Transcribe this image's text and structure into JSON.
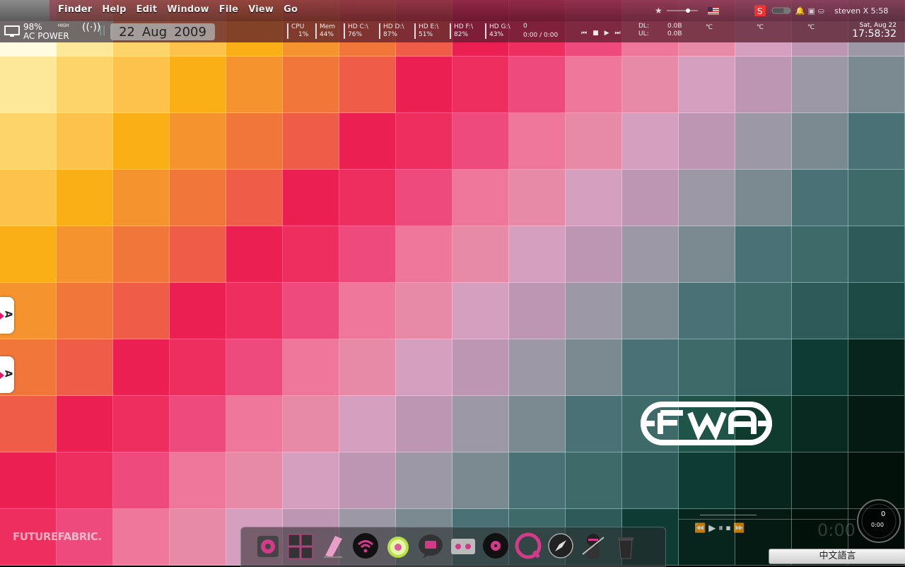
{
  "menubar": {
    "items": [
      "Finder",
      "Help",
      "Edit",
      "Window",
      "File",
      "View",
      "Go"
    ],
    "user_time": "steven X 5:58"
  },
  "statusbar": {
    "battery_percent": "98%",
    "battery_level_label": "HIGH",
    "power_source": "AC POWER",
    "date": {
      "day": "22",
      "month": "Aug",
      "year": "2009"
    },
    "meters": [
      {
        "label": "CPU",
        "value": "1%"
      },
      {
        "label": "Mem",
        "value": "44%"
      },
      {
        "label": "HD C:\\",
        "value": "76%"
      },
      {
        "label": "HD D:\\",
        "value": "87%"
      },
      {
        "label": "HD E:\\",
        "value": "51%"
      },
      {
        "label": "HD F:\\",
        "value": "82%"
      },
      {
        "label": "HD G:\\",
        "value": "43%"
      }
    ],
    "media_count": "0",
    "media_time": "0:00 / 0:00",
    "network": {
      "dl_label": "DL:",
      "dl_value": "0.0B",
      "ul_label": "UL:",
      "ul_value": "0.0B"
    },
    "temps": [
      "℃",
      "℃",
      "℃"
    ],
    "clock_date": "Sat, Aug 22",
    "clock_time": "17:58:32"
  },
  "side_tabs": [
    {
      "letter": "A"
    },
    {
      "letter": "A"
    }
  ],
  "brand_text": "FUTUREFABRIC.",
  "media_widget": {
    "time": "0:00",
    "dial_count": "0",
    "dial_time": "0:00"
  },
  "language_bar": {
    "label": "中文語言"
  },
  "dock": {
    "icons": [
      "cd-burner-icon",
      "grid-app-icon",
      "beach-chair-icon",
      "wifi-icon",
      "lime-icon",
      "ichat-icon",
      "cassette-icon",
      "vinyl-record-icon",
      "quicktime-icon",
      "safari-compass-icon",
      "ninja-icon",
      "trash-icon"
    ]
  },
  "colors": {
    "grid": [
      [
        "#fffbe0",
        "#fde89a",
        "#fdd46a",
        "#fdc24c",
        "#fbaf17",
        "#f5932f",
        "#f1763a",
        "#ef5c48",
        "#ec1f53",
        "#ed2e5f",
        "#ef4a7d",
        "#f0779c",
        "#e78aa7",
        "#d5a0bf",
        "#bd96b4",
        "#9c98a5"
      ],
      [
        "#fde89a",
        "#fdd46a",
        "#fdc24c",
        "#fbaf17",
        "#f5932f",
        "#f1763a",
        "#ef5c48",
        "#ec1f53",
        "#ed2e5f",
        "#ef4a7d",
        "#f0779c",
        "#e78aa7",
        "#d5a0bf",
        "#bd96b4",
        "#9c98a5",
        "#7a8a90"
      ],
      [
        "#fdd46a",
        "#fdc24c",
        "#fbaf17",
        "#f5932f",
        "#f1763a",
        "#ef5c48",
        "#ec1f53",
        "#ed2e5f",
        "#ef4a7d",
        "#f0779c",
        "#e78aa7",
        "#d5a0bf",
        "#bd96b4",
        "#9c98a5",
        "#7a8a90",
        "#4a7276"
      ],
      [
        "#fdc24c",
        "#fbaf17",
        "#f5932f",
        "#f1763a",
        "#ef5c48",
        "#ec1f53",
        "#ed2e5f",
        "#ef4a7d",
        "#f0779c",
        "#e78aa7",
        "#d5a0bf",
        "#bd96b4",
        "#9c98a5",
        "#7a8a90",
        "#4a7276",
        "#3f6a6a"
      ],
      [
        "#fbaf17",
        "#f5932f",
        "#f1763a",
        "#ef5c48",
        "#ec1f53",
        "#ed2e5f",
        "#ef4a7d",
        "#f0779c",
        "#e78aa7",
        "#d5a0bf",
        "#bd96b4",
        "#9c98a5",
        "#7a8a90",
        "#4a7276",
        "#3f6a6a",
        "#2e5a5a"
      ],
      [
        "#f5932f",
        "#f1763a",
        "#ef5c48",
        "#ec1f53",
        "#ed2e5f",
        "#ef4a7d",
        "#f0779c",
        "#e78aa7",
        "#d5a0bf",
        "#bd96b4",
        "#9c98a5",
        "#7a8a90",
        "#4a7276",
        "#3f6a6a",
        "#2e5a5a",
        "#1d4a45"
      ],
      [
        "#f1763a",
        "#ef5c48",
        "#ec1f53",
        "#ed2e5f",
        "#ef4a7d",
        "#f0779c",
        "#e78aa7",
        "#d5a0bf",
        "#bd96b4",
        "#9c98a5",
        "#7a8a90",
        "#4a7276",
        "#3f6a6a",
        "#2e5a5a",
        "#0e3b33",
        "#07251c"
      ],
      [
        "#ef5c48",
        "#ec1f53",
        "#ed2e5f",
        "#ef4a7d",
        "#f0779c",
        "#e78aa7",
        "#d5a0bf",
        "#bd96b4",
        "#9c98a5",
        "#7a8a90",
        "#4a7276",
        "#3f6a6a",
        "#1f5548",
        "#0f3a2e",
        "#082a20",
        "#051a12"
      ],
      [
        "#ec1f53",
        "#ed2e5f",
        "#ef4a7d",
        "#f0779c",
        "#e78aa7",
        "#d5a0bf",
        "#bd96b4",
        "#9c98a5",
        "#7a8a90",
        "#4a7276",
        "#3f6a6a",
        "#2e5a5a",
        "#0e3b33",
        "#07251c",
        "#051a12",
        "#03110b"
      ],
      [
        "#ed2e5f",
        "#ef4a7d",
        "#f0779c",
        "#e78aa7",
        "#d5a0bf",
        "#bd96b4",
        "#9c98a5",
        "#7a8a90",
        "#4a7276",
        "#3f6a6a",
        "#2e5a5a",
        "#0e3b33",
        "#07251c",
        "#051a12",
        "#03110b",
        "#020b07"
      ]
    ]
  }
}
